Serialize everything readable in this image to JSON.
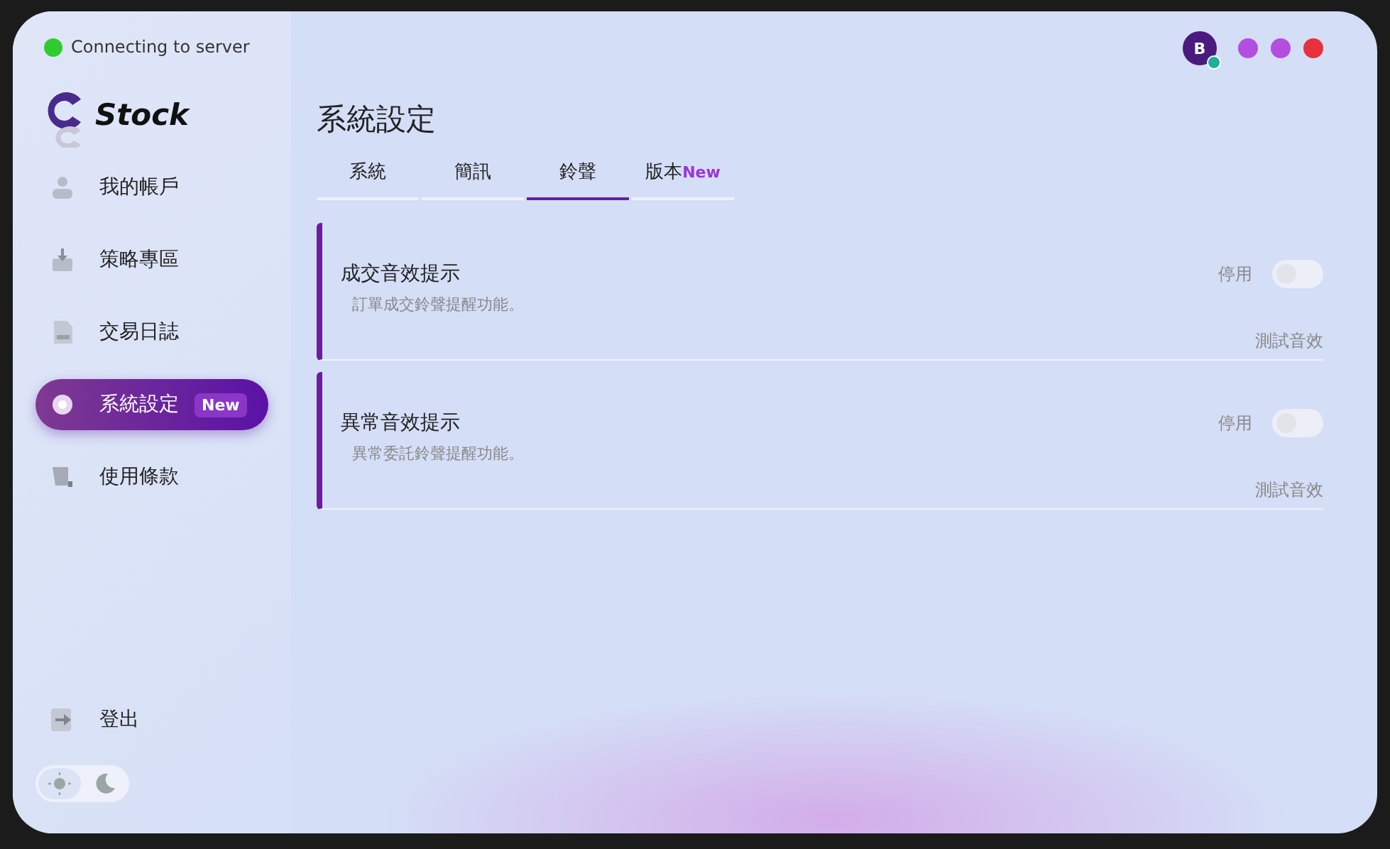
{
  "status": {
    "text": "Connecting to server",
    "connected": true
  },
  "logo": {
    "text": "Stock"
  },
  "nav": {
    "items": [
      {
        "label": "我的帳戶",
        "kind": "user",
        "selected": false
      },
      {
        "label": "策略專區",
        "kind": "download",
        "selected": false
      },
      {
        "label": "交易日誌",
        "kind": "log",
        "selected": false
      },
      {
        "label": "系統設定",
        "kind": "gear",
        "selected": true,
        "badge": "New"
      },
      {
        "label": "使用條款",
        "kind": "scroll",
        "selected": false
      }
    ]
  },
  "logout": {
    "label": "登出"
  },
  "theme": {
    "options": [
      {
        "kind": "light",
        "selected": true
      },
      {
        "kind": "dark",
        "selected": false
      }
    ]
  },
  "avatar": {
    "letter": "B",
    "online": true
  },
  "window_controls": [
    {
      "color": "#b44ee0"
    },
    {
      "color": "#b44ee0"
    },
    {
      "color": "#e8303e"
    }
  ],
  "page_title": "系統設定",
  "tabs": [
    {
      "label": "系統",
      "selected": false
    },
    {
      "label": "簡訊",
      "selected": false
    },
    {
      "label": "鈴聲",
      "selected": true
    },
    {
      "label": "版本",
      "selected": false,
      "badge": "New"
    }
  ],
  "settings": [
    {
      "title": "成交音效提示",
      "description": "訂單成交鈴聲提醒功能。",
      "toggle_label": "停用",
      "on": false,
      "action": "測試音效"
    },
    {
      "title": "異常音效提示",
      "description": "異常委託鈴聲提醒功能。",
      "toggle_label": "停用",
      "on": false,
      "action": "測試音效"
    }
  ]
}
